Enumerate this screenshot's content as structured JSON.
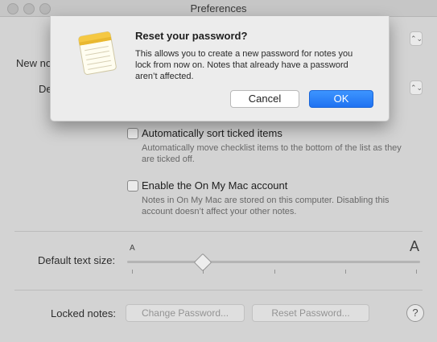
{
  "window": {
    "title": "Preferences"
  },
  "prefs": {
    "label_new_notes_partial": "New no",
    "label_default_partial": "De",
    "option_sort": {
      "title": "Automatically sort ticked items",
      "description": "Automatically move checklist items to the bottom of the list as they are ticked off."
    },
    "option_on_my_mac": {
      "title": "Enable the On My Mac account",
      "description": "Notes in On My Mac are stored on this computer. Disabling this account doesn’t affect your other notes."
    },
    "text_size": {
      "label": "Default text size:",
      "small_glyph": "A",
      "large_glyph": "A",
      "level_fraction": 0.25
    },
    "locked_notes": {
      "label": "Locked notes:",
      "change_password": "Change Password...",
      "reset_password": "Reset Password..."
    },
    "help_symbol": "?",
    "select_chevron": "⌃⌄"
  },
  "alert": {
    "icon": "notes-app-icon",
    "title": "Reset your password?",
    "message": "This allows you to create a new password for notes you lock from now on. Notes that already have a password aren’t affected.",
    "cancel_label": "Cancel",
    "ok_label": "OK",
    "accent_color": "#1f72f1"
  }
}
